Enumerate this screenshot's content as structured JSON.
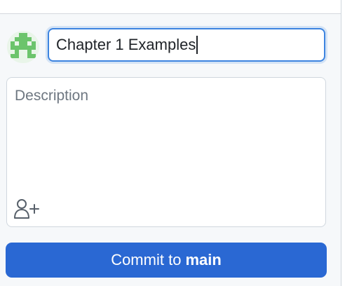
{
  "commit": {
    "summary_value": "Chapter 1 Examples",
    "description_placeholder": "Description",
    "button_prefix": "Commit to",
    "branch": "main"
  },
  "icons": {
    "avatar": "pixel-identicon-avatar",
    "coauthor": "person-add-icon"
  },
  "colors": {
    "button": "#2a68d3",
    "focus_border": "#3d84e0",
    "avatar_green": "#6cc46c"
  }
}
